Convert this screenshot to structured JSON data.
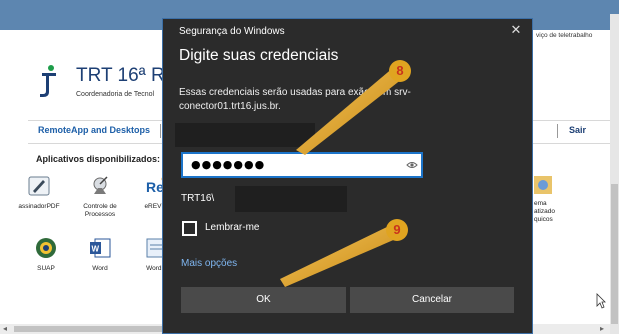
{
  "background_page": {
    "banner_text": "viço de teletrabalho",
    "org": {
      "title": "TRT 16ª Regi",
      "subtitle": "Coordenadoria de Tecnol"
    },
    "nav": {
      "remoteapp_label": "RemoteApp and Desktops",
      "exit_label": "Sair"
    },
    "apps_heading": "Aplicativos disponibilizados:",
    "apps": [
      {
        "label": "assinadorPDF",
        "icon": "pen-sign-icon"
      },
      {
        "label": "Controle de Processos",
        "icon": "satellite-icon"
      },
      {
        "label": "eREVIS",
        "icon": "erevis-logo-icon"
      },
      {
        "label": "SUAP",
        "icon": "seal-icon"
      },
      {
        "label": "Word",
        "icon": "word-icon"
      },
      {
        "label": "WordP",
        "icon": "wordpad-icon"
      }
    ],
    "partial_app_label": "ema\natizado\nquicos"
  },
  "dialog": {
    "caption": "Segurança do Windows",
    "heading": "Digite suas credenciais",
    "description": "Essas credenciais serão usadas para      exão com srv-conector01.trt16.jus.br.",
    "password_mask": "●●●●●●●",
    "domain_prefix": "TRT16\\",
    "remember_label": "Lembrar-me",
    "remember_checked": false,
    "more_options_label": "Mais opções",
    "ok_label": "OK",
    "cancel_label": "Cancelar"
  },
  "callouts": [
    {
      "number": "8",
      "target": "password-field"
    },
    {
      "number": "9",
      "target": "ok-button"
    }
  ],
  "colors": {
    "dialog_bg": "#2b2b2b",
    "accent_border": "#1c74c9",
    "callout": "#e0a420",
    "callout_number": "#c9331c",
    "link": "#7fb6f0"
  }
}
